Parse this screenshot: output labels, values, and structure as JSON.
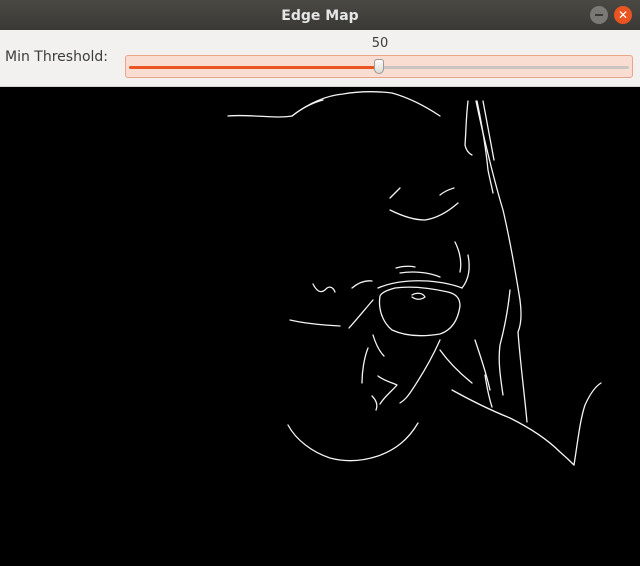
{
  "window": {
    "title": "Edge Map",
    "minimize_icon": "minimize-icon",
    "close_icon": "close-icon"
  },
  "toolbar": {
    "slider_label": "Min Threshold:",
    "slider_value": "50",
    "slider_fraction": 0.5,
    "accent_color": "#e95420"
  }
}
